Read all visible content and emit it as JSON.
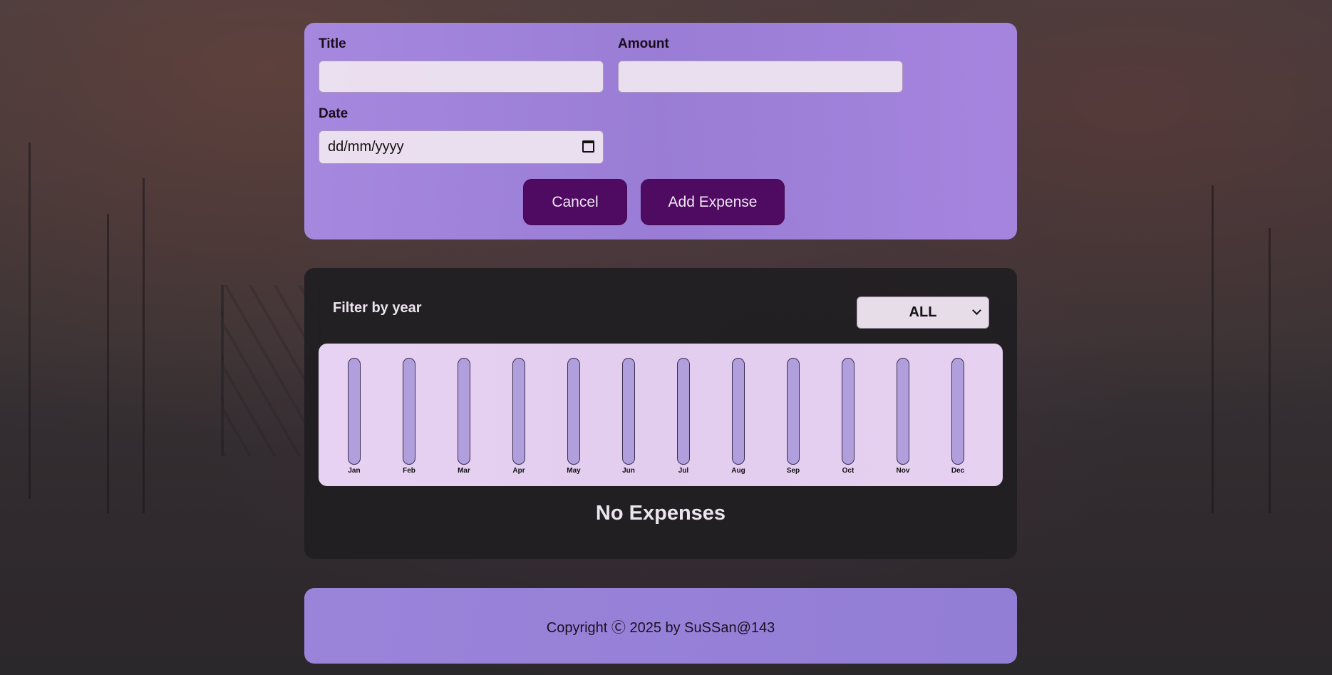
{
  "form": {
    "title_label": "Title",
    "title_value": "",
    "amount_label": "Amount",
    "amount_value": "",
    "date_label": "Date",
    "date_placeholder": "dd/mm/yyyy",
    "cancel_label": "Cancel",
    "add_label": "Add Expense"
  },
  "filter": {
    "label": "Filter by year",
    "selected_year": "ALL"
  },
  "chart_data": {
    "type": "bar",
    "categories": [
      "Jan",
      "Feb",
      "Mar",
      "Apr",
      "May",
      "Jun",
      "Jul",
      "Aug",
      "Sep",
      "Oct",
      "Nov",
      "Dec"
    ],
    "values": [
      0,
      0,
      0,
      0,
      0,
      0,
      0,
      0,
      0,
      0,
      0,
      0
    ]
  },
  "expenses": {
    "empty_message": "No Expenses"
  },
  "footer": {
    "text": "Copyright Ⓒ 2025 by SuSSan@143"
  },
  "colors": {
    "accent": "#4f0a62",
    "form_bg": "#a88ae4",
    "chart_bg": "#e8d2f3",
    "bar_empty": "#b09fdc"
  }
}
